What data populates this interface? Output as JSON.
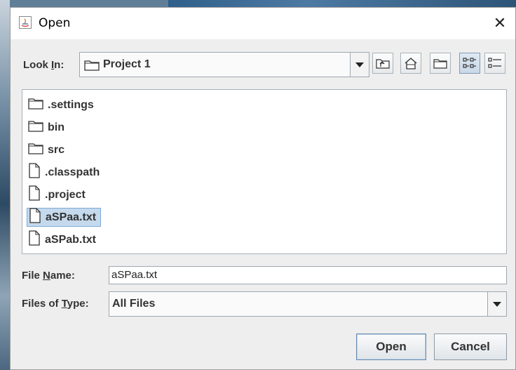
{
  "window": {
    "title": "Open",
    "close_glyph": "✕"
  },
  "look_in": {
    "label_pre": "Look ",
    "label_mnemonic": "I",
    "label_post": "n:",
    "value": "Project 1"
  },
  "toolbar": {
    "icons": [
      "up-one-level-icon",
      "home-icon",
      "new-folder-icon",
      "list-view-icon",
      "details-view-icon"
    ],
    "active": "list-view-icon"
  },
  "files": [
    {
      "name": ".settings",
      "type": "folder",
      "selected": false
    },
    {
      "name": "bin",
      "type": "folder",
      "selected": false
    },
    {
      "name": "src",
      "type": "folder",
      "selected": false
    },
    {
      "name": ".classpath",
      "type": "file",
      "selected": false
    },
    {
      "name": ".project",
      "type": "file",
      "selected": false
    },
    {
      "name": "aSPaa.txt",
      "type": "file",
      "selected": true
    },
    {
      "name": "aSPab.txt",
      "type": "file",
      "selected": false
    }
  ],
  "file_name": {
    "label_pre": "File ",
    "label_mnemonic": "N",
    "label_post": "ame:",
    "value": "aSPaa.txt"
  },
  "file_type": {
    "label_pre": "Files of ",
    "label_mnemonic": "T",
    "label_post": "ype:",
    "value": "All Files"
  },
  "buttons": {
    "open": "Open",
    "cancel": "Cancel"
  },
  "colors": {
    "selection": "#c5d9ed",
    "window_bg": "#eeeeee"
  }
}
